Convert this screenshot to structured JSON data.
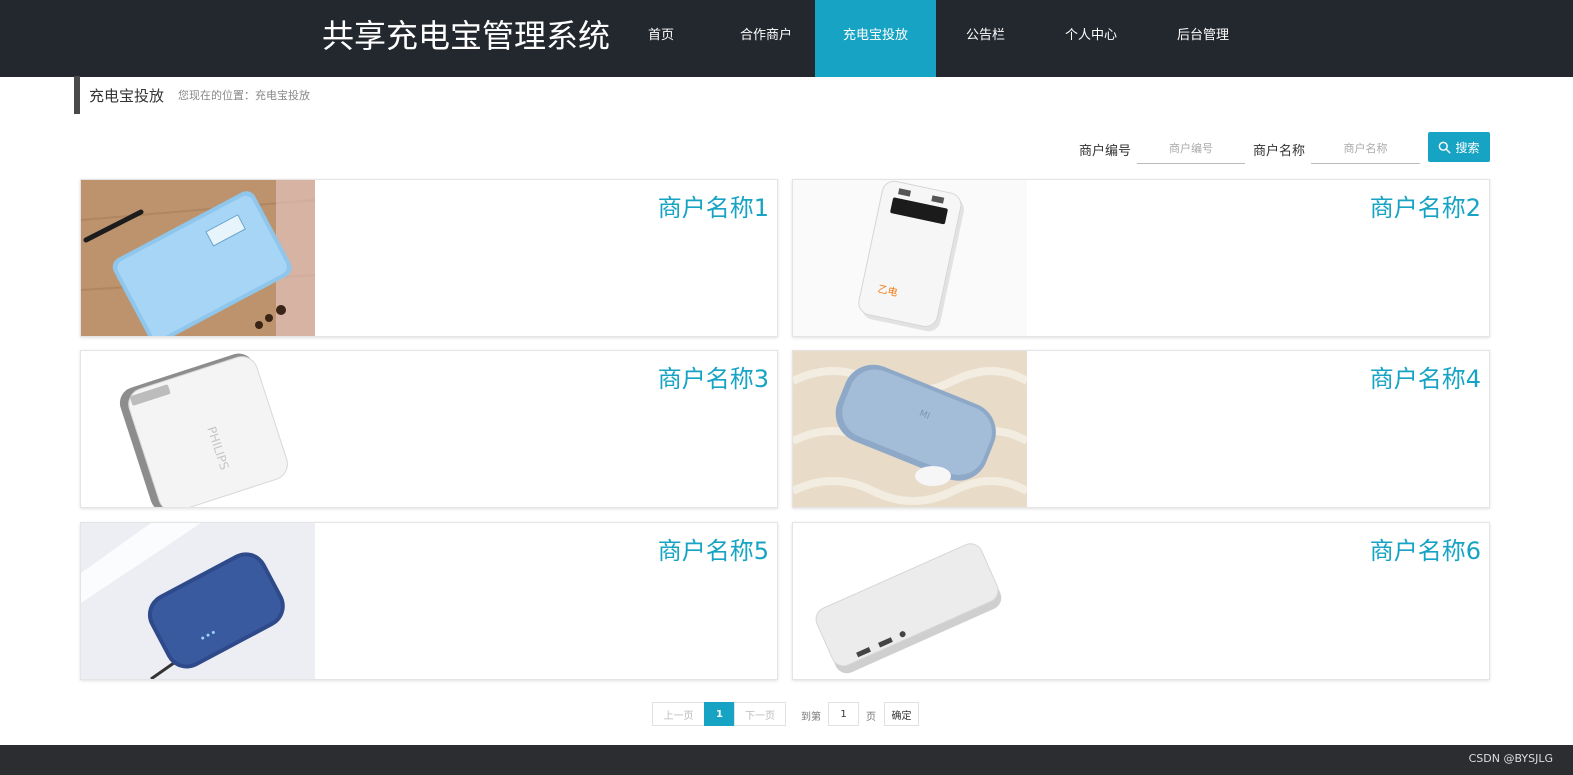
{
  "header": {
    "site_title": "共享充电宝管理系统",
    "nav": [
      {
        "label": "首页",
        "active": false
      },
      {
        "label": "合作商户",
        "active": false
      },
      {
        "label": "充电宝投放",
        "active": true
      },
      {
        "label": "公告栏",
        "active": false
      },
      {
        "label": "个人中心",
        "active": false
      },
      {
        "label": "后台管理",
        "active": false
      }
    ]
  },
  "breadcrumb": {
    "title": "充电宝投放",
    "location": "您现在的位置：充电宝投放"
  },
  "search": {
    "merchant_no_label": "商户编号",
    "merchant_no_placeholder": "商户编号",
    "merchant_name_label": "商户名称",
    "merchant_name_placeholder": "商户名称",
    "button_label": "搜索"
  },
  "cards": [
    {
      "name": "商户名称1",
      "image": "light-blue-power-bank-on-wood"
    },
    {
      "name": "商户名称2",
      "image": "white-power-bank-with-display"
    },
    {
      "name": "商户名称3",
      "image": "white-philips-power-bank"
    },
    {
      "name": "商户名称4",
      "image": "silver-blue-mi-power-bank"
    },
    {
      "name": "商户名称5",
      "image": "navy-power-bank-with-cable"
    },
    {
      "name": "商户名称6",
      "image": "white-slim-power-bank"
    }
  ],
  "pagination": {
    "prev_label": "上一页",
    "current_page": "1",
    "next_label": "下一页",
    "goto_label": "到第",
    "goto_value": "1",
    "page_unit": "页",
    "confirm_label": "确定"
  },
  "footer": {
    "text": "CSDN @BYSJLG"
  },
  "colors": {
    "accent": "#17a3c4",
    "header_bg": "#23282f",
    "footer_bg": "#2b2d30"
  }
}
